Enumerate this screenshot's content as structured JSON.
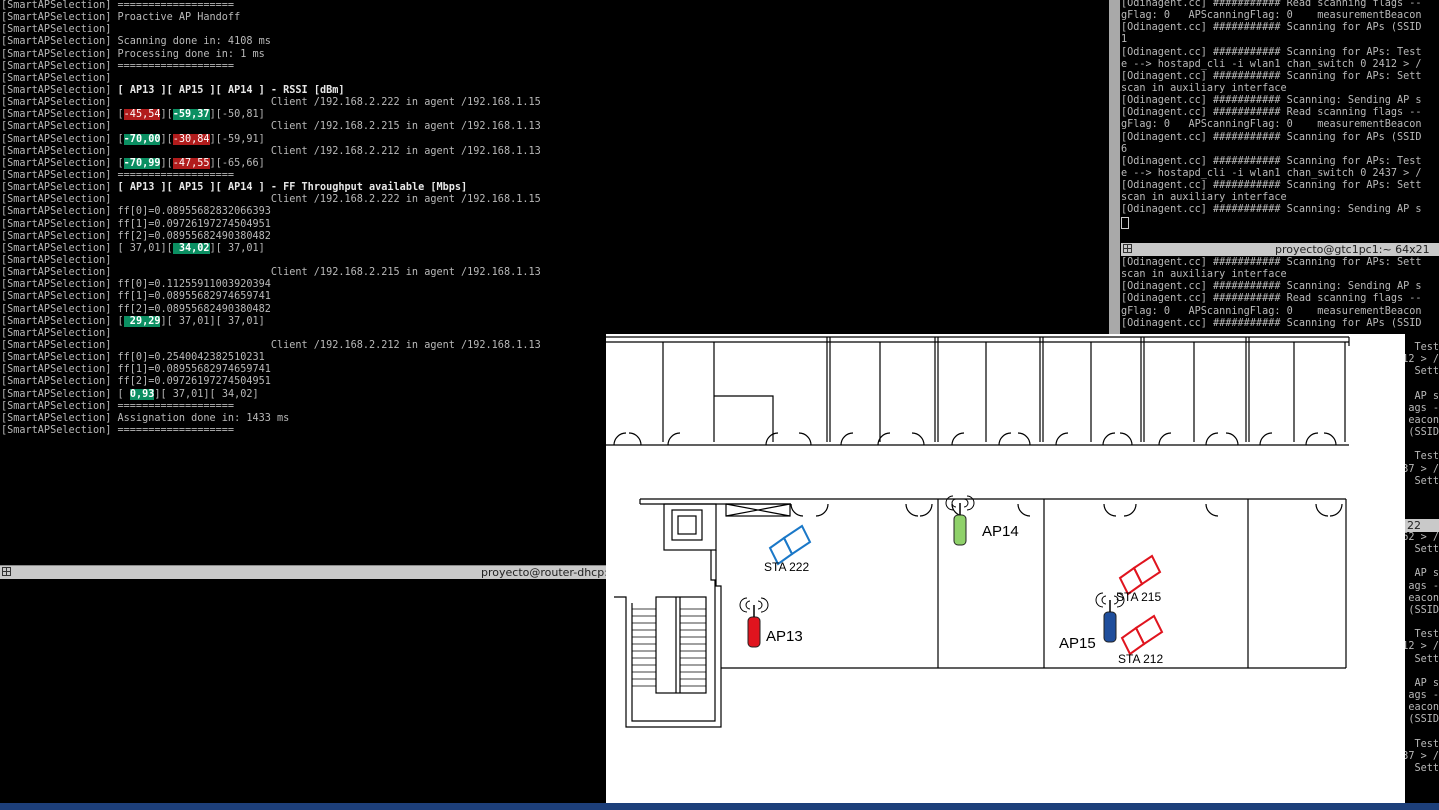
{
  "main_terminal": {
    "lines": [
      [
        {
          "t": "[SmartAPSelection] ==================="
        }
      ],
      [
        {
          "t": "[SmartAPSelection] Proactive AP Handoff"
        }
      ],
      [
        {
          "t": "[SmartAPSelection]"
        }
      ],
      [
        {
          "t": "[SmartAPSelection] Scanning done in: 4108 ms"
        }
      ],
      [
        {
          "t": "[SmartAPSelection] Processing done in: 1 ms"
        }
      ],
      [
        {
          "t": "[SmartAPSelection] ==================="
        }
      ],
      [
        {
          "t": "[SmartAPSelection]"
        }
      ],
      [
        {
          "t": "[SmartAPSelection] "
        },
        {
          "t": "[ AP13 ][ AP15 ][ AP14 ] - RSSI [dBm]",
          "c": "bold"
        }
      ],
      [
        {
          "t": "[SmartAPSelection]                          Client /192.168.2.222 in agent /192.168.1.15"
        }
      ],
      [
        {
          "t": "[SmartAPSelection] ["
        },
        {
          "t": "-45,54",
          "c": "red"
        },
        {
          "t": "]["
        },
        {
          "t": "-59,37",
          "c": "green"
        },
        {
          "t": "][-50,81]"
        }
      ],
      [
        {
          "t": "[SmartAPSelection]                          Client /192.168.2.215 in agent /192.168.1.13"
        }
      ],
      [
        {
          "t": "[SmartAPSelection] ["
        },
        {
          "t": "-70,00",
          "c": "green"
        },
        {
          "t": "]["
        },
        {
          "t": "-30,84",
          "c": "red"
        },
        {
          "t": "][-59,91]"
        }
      ],
      [
        {
          "t": "[SmartAPSelection]                          Client /192.168.2.212 in agent /192.168.1.13"
        }
      ],
      [
        {
          "t": "[SmartAPSelection] ["
        },
        {
          "t": "-70,99",
          "c": "green"
        },
        {
          "t": "]["
        },
        {
          "t": "-47,55",
          "c": "red"
        },
        {
          "t": "][-65,66]"
        }
      ],
      [
        {
          "t": "[SmartAPSelection] ==================="
        }
      ],
      [
        {
          "t": "[SmartAPSelection] "
        },
        {
          "t": "[ AP13 ][ AP15 ][ AP14 ] - FF Throughput available [Mbps]",
          "c": "bold"
        }
      ],
      [
        {
          "t": "[SmartAPSelection]                          Client /192.168.2.222 in agent /192.168.1.15"
        }
      ],
      [
        {
          "t": "[SmartAPSelection] ff[0]=0.08955682832066393"
        }
      ],
      [
        {
          "t": "[SmartAPSelection] ff[1]=0.09726197274504951"
        }
      ],
      [
        {
          "t": "[SmartAPSelection] ff[2]=0.08955682490380482"
        }
      ],
      [
        {
          "t": "[SmartAPSelection] [ 37,01]["
        },
        {
          "t": " 34,02",
          "c": "green"
        },
        {
          "t": "][ 37,01]"
        }
      ],
      [
        {
          "t": "[SmartAPSelection]"
        }
      ],
      [
        {
          "t": "[SmartAPSelection]                          Client /192.168.2.215 in agent /192.168.1.13"
        }
      ],
      [
        {
          "t": "[SmartAPSelection] ff[0]=0.11255911003920394"
        }
      ],
      [
        {
          "t": "[SmartAPSelection] ff[1]=0.08955682974659741"
        }
      ],
      [
        {
          "t": "[SmartAPSelection] ff[2]=0.08955682490380482"
        }
      ],
      [
        {
          "t": "[SmartAPSelection] ["
        },
        {
          "t": " 29,29",
          "c": "green"
        },
        {
          "t": "][ 37,01][ 37,01]"
        }
      ],
      [
        {
          "t": "[SmartAPSelection]"
        }
      ],
      [
        {
          "t": "[SmartAPSelection]                          Client /192.168.2.212 in agent /192.168.1.13"
        }
      ],
      [
        {
          "t": "[SmartAPSelection] ff[0]=0.2540042382510231"
        }
      ],
      [
        {
          "t": "[SmartAPSelection] ff[1]=0.08955682974659741"
        }
      ],
      [
        {
          "t": "[SmartAPSelection] ff[2]=0.09726197274504951"
        }
      ],
      [
        {
          "t": "[SmartAPSelection] [ "
        },
        {
          "t": "0,93",
          "c": "green"
        },
        {
          "t": "][ 37,01][ 34,02]"
        }
      ],
      [
        {
          "t": "[SmartAPSelection] ==================="
        }
      ],
      [
        {
          "t": "[SmartAPSelection] Assignation done in: 1433 ms"
        }
      ],
      [
        {
          "t": "[SmartAPSelection] ==================="
        }
      ]
    ]
  },
  "lower_terminal": {
    "title": "proyecto@router-dhcp: ~"
  },
  "right_top_terminal": {
    "lines": [
      "[Odinagent.cc] ########### Read scanning flags --",
      "gFlag: 0   APScanningFlag: 0    measurementBeacon",
      "[Odinagent.cc] ########### Scanning for APs (SSID",
      "1",
      "[Odinagent.cc] ########### Scanning for APs: Test",
      "e --> hostapd_cli -i wlan1 chan_switch 0 2412 > /",
      "[Odinagent.cc] ########### Scanning for APs: Sett",
      "scan in auxiliary interface",
      "[Odinagent.cc] ########### Scanning: Sending AP s",
      "[Odinagent.cc] ########### Read scanning flags --",
      "gFlag: 0   APScanningFlag: 0    measurementBeacon",
      "[Odinagent.cc] ########### Scanning for APs (SSID",
      "6",
      "[Odinagent.cc] ########### Scanning for APs: Test",
      "e --> hostapd_cli -i wlan1 chan_switch 0 2437 > /",
      "[Odinagent.cc] ########### Scanning for APs: Sett",
      "scan in auxiliary interface",
      "[Odinagent.cc] ########### Scanning: Sending AP s"
    ]
  },
  "right_mid_terminal": {
    "title": "proyecto@gtc1pc1:~ 64x21",
    "lines": [
      "[Odinagent.cc] ########### Scanning for APs: Sett",
      "scan in auxiliary interface",
      "[Odinagent.cc] ########### Scanning: Sending AP s",
      "[Odinagent.cc] ########### Read scanning flags --",
      "gFlag: 0   APScanningFlag: 0    measurementBeacon",
      "[Odinagent.cc] ########### Scanning for APs (SSID"
    ]
  },
  "right_edge_fragments": [
    {
      "text": "Test",
      "row": 0
    },
    {
      "text": "12 > /",
      "row": 1
    },
    {
      "text": "Sett",
      "row": 2
    },
    {
      "text": "AP s",
      "row": 4
    },
    {
      "text": "ags -",
      "row": 5
    },
    {
      "text": "eacon",
      "row": 6
    },
    {
      "text": "(SSID",
      "row": 7
    },
    {
      "text": "Test",
      "row": 9
    },
    {
      "text": "37 > /",
      "row": 10
    },
    {
      "text": "Sett",
      "row": 11
    }
  ],
  "right_bottom_terminal": {
    "title": "22",
    "fragments": [
      {
        "text": "62 > /",
        "row": 0
      },
      {
        "text": "Sett",
        "row": 1
      },
      {
        "text": "AP s",
        "row": 3
      },
      {
        "text": "ags -",
        "row": 4
      },
      {
        "text": "eacon",
        "row": 5
      },
      {
        "text": "(SSID",
        "row": 6
      },
      {
        "text": "Test",
        "row": 8
      },
      {
        "text": "12 > /",
        "row": 9
      },
      {
        "text": "Sett",
        "row": 10
      },
      {
        "text": "AP s",
        "row": 12
      },
      {
        "text": "ags -",
        "row": 13
      },
      {
        "text": "eacon",
        "row": 14
      },
      {
        "text": "(SSID",
        "row": 15
      },
      {
        "text": "Test",
        "row": 17
      },
      {
        "text": "37 > /",
        "row": 18
      },
      {
        "text": "Sett",
        "row": 19
      }
    ]
  },
  "floor_plan": {
    "access_points": [
      {
        "label": "AP13",
        "color": "#e0141e"
      },
      {
        "label": "AP14",
        "color": "#8fd16a"
      },
      {
        "label": "AP15",
        "color": "#1f4e9c"
      }
    ],
    "stations": [
      {
        "label": "STA 222",
        "color": "#1a78c8"
      },
      {
        "label": "STA 215",
        "color": "#e0141e"
      },
      {
        "label": "STA 212",
        "color": "#e0141e"
      }
    ]
  },
  "colors": {
    "rssi_worst": "#b11c1c",
    "selected": "#0b8f62",
    "taskbar": "#1d3f7a"
  }
}
